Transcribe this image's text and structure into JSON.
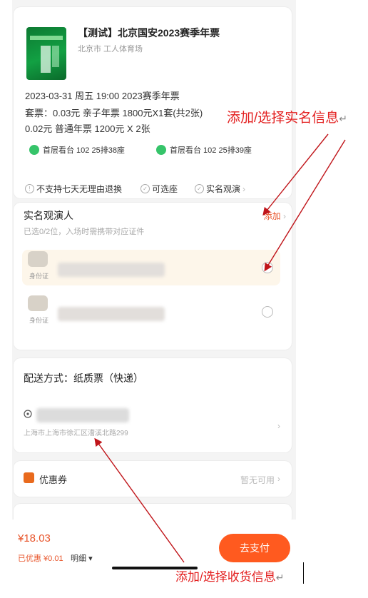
{
  "event": {
    "title": "【测试】北京国安2023赛季年票",
    "venue": "北京市 工人体育场",
    "datetime": "2023-03-31 周五 19:00 2023赛季年票",
    "ticket_line1": "套票：0.03元 亲子年票 1800元X1套(共2张)",
    "ticket_line2": "0.02元 普通年票 1200元 X 2张",
    "seats": [
      "首层看台 102 25排38座",
      "首层看台 102 25排39座"
    ],
    "policies": [
      "不支持七天无理由退换",
      "可选座",
      "实名观演"
    ]
  },
  "viewers": {
    "title": "实名观演人",
    "add_label": "添加",
    "hint": "已选0/2位，入场时需携带对应证件",
    "id_label": "身份证"
  },
  "delivery": {
    "title": "配送方式：纸质票（快递）",
    "address": "上海市上海市徐汇区漕溪北路299"
  },
  "coupon": {
    "label": "优惠券",
    "value": "暂无可用"
  },
  "footer": {
    "price": "¥18.03",
    "paid": "已优惠 ¥0.01",
    "detail": "明细",
    "pay_button": "去支付"
  },
  "annotations": {
    "top": "添加/选择实名信息",
    "bottom": "添加/选择收货信息"
  },
  "colors": {
    "accent": "#e8542a",
    "pay_button": "#ff5a1f",
    "annotation": "#e32020",
    "seat_dot": "#36c46a"
  }
}
